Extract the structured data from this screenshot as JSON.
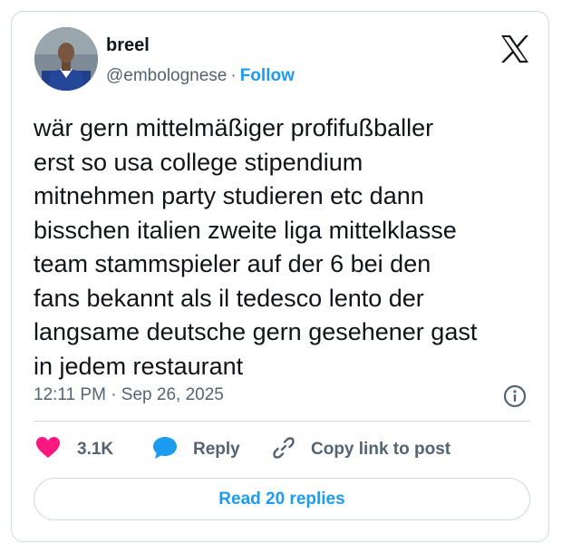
{
  "author": {
    "display_name": "breel",
    "handle": "@embolognese",
    "separator": "·",
    "follow_label": "Follow"
  },
  "tweet": {
    "text": "wär gern mittelmäßiger profifußballer\nerst so usa college stipendium\nmitnehmen party studieren etc dann\nbisschen italien zweite liga mittelklasse\nteam stammspieler auf der 6 bei den\nfans bekannt als il tedesco lento der\nlangsame deutsche gern gesehener gast\nin jedem restaurant",
    "timestamp": "12:11 PM · Sep 26, 2025"
  },
  "actions": {
    "like_count": "3.1K",
    "reply_label": "Reply",
    "copy_label": "Copy link to post"
  },
  "read_replies_label": "Read 20 replies",
  "icons": {
    "logo": "x-logo-icon",
    "info": "info-icon",
    "like": "heart-icon",
    "reply": "speech-bubble-icon",
    "copy": "link-icon"
  },
  "colors": {
    "accent": "#1d9bf0",
    "like": "#f91880",
    "muted": "#536471",
    "text": "#0f1419",
    "border": "#cfd9de"
  }
}
